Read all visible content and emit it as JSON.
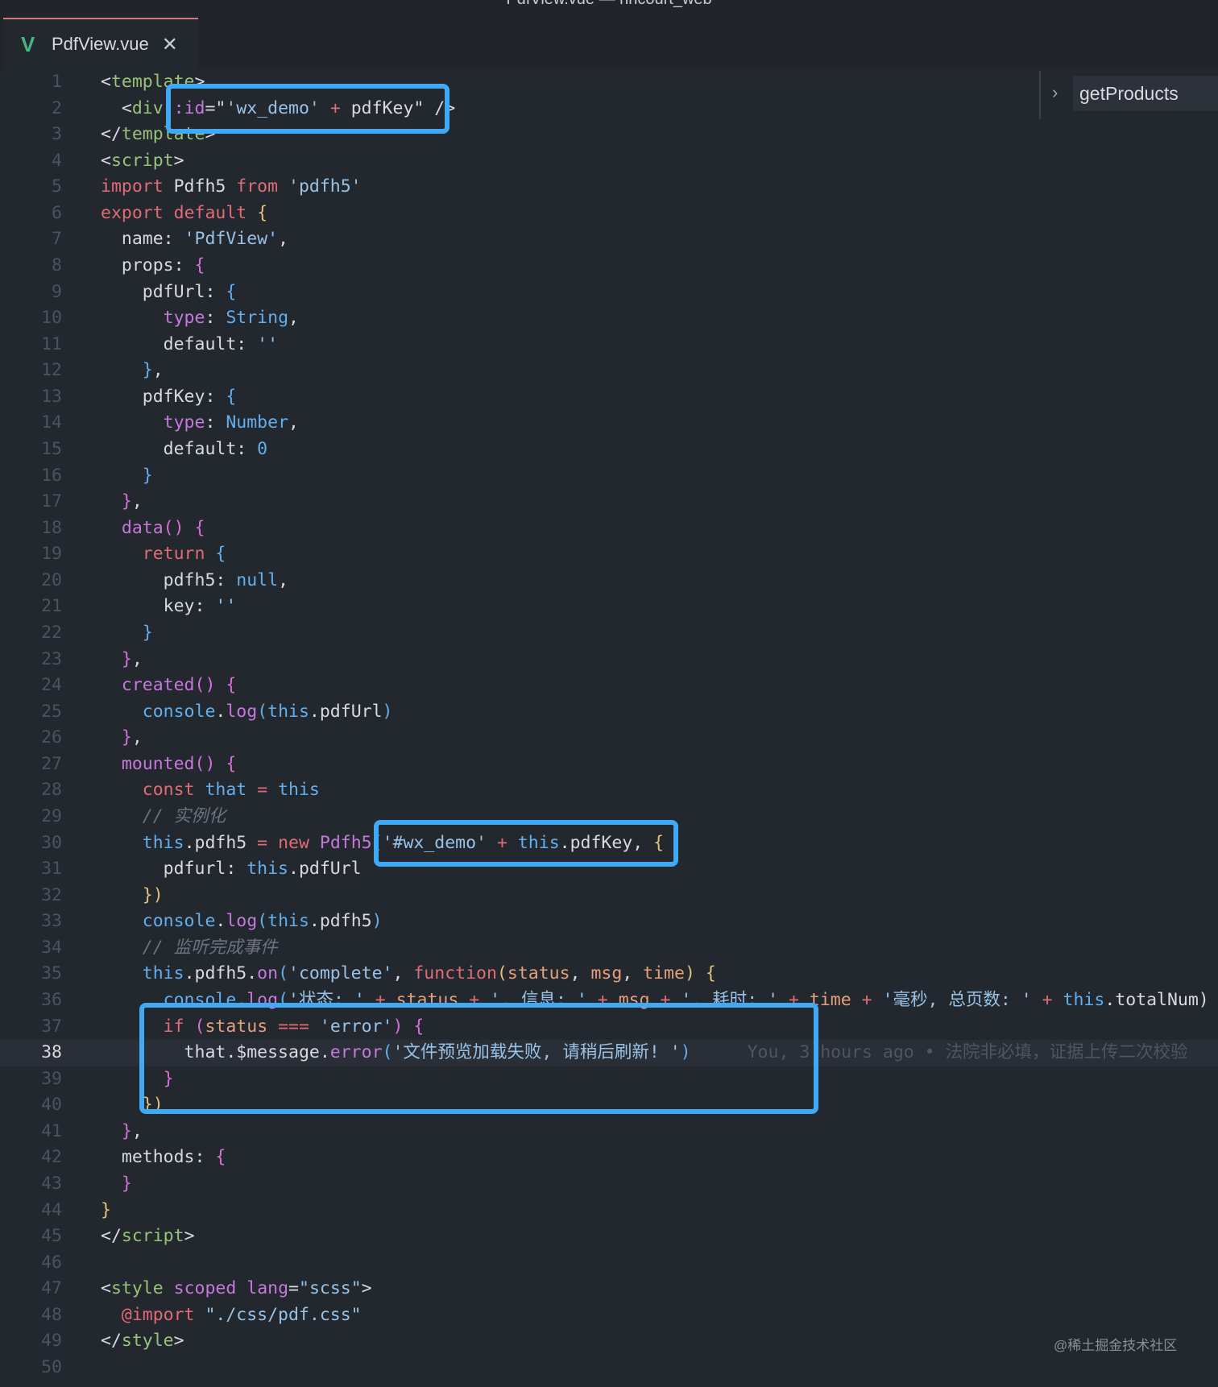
{
  "window": {
    "title": "PdfView.vue — hncourt_web"
  },
  "tab": {
    "icon": "vue-icon",
    "label": "PdfView.vue",
    "close": "✕"
  },
  "breadcrumb": {
    "item": "getProducts"
  },
  "colors": {
    "highlight_box": "#3fa9f5",
    "editor_bg": "#23272e"
  },
  "current_line": 38,
  "blame": "You, 3 hours ago • 法院非必填，证据上传二次校验",
  "watermark": "@稀土掘金技术社区",
  "lines": [
    [
      [
        "<",
        "p"
      ],
      [
        "template",
        "tag"
      ],
      [
        ">",
        "p"
      ]
    ],
    [
      [
        "  <",
        "p"
      ],
      [
        "div",
        "tag"
      ],
      [
        " ",
        "p"
      ],
      [
        ":id",
        "f"
      ],
      [
        "=\"",
        "p"
      ],
      [
        "'wx_demo'",
        "s"
      ],
      [
        " + ",
        "m"
      ],
      [
        "pdfKey",
        "p"
      ],
      [
        "\"",
        "p"
      ],
      [
        " />",
        "p"
      ]
    ],
    [
      [
        "</",
        "p"
      ],
      [
        "template",
        "tag"
      ],
      [
        ">",
        "p"
      ]
    ],
    [
      [
        "<",
        "p"
      ],
      [
        "script",
        "tag"
      ],
      [
        ">",
        "p"
      ]
    ],
    [
      [
        "import",
        "k"
      ],
      [
        " Pdfh5 ",
        "p"
      ],
      [
        "from",
        "k"
      ],
      [
        " ",
        "p"
      ],
      [
        "'pdfh5'",
        "s"
      ]
    ],
    [
      [
        "export",
        "k"
      ],
      [
        " ",
        "p"
      ],
      [
        "default",
        "k"
      ],
      [
        " ",
        "p"
      ],
      [
        "{",
        "y"
      ]
    ],
    [
      [
        "  name: ",
        "p"
      ],
      [
        "'PdfView'",
        "s"
      ],
      [
        ",",
        "p"
      ]
    ],
    [
      [
        "  props: ",
        "p"
      ],
      [
        "{",
        "pk"
      ]
    ],
    [
      [
        "    pdfUrl: ",
        "p"
      ],
      [
        "{",
        "b"
      ]
    ],
    [
      [
        "      ",
        "p"
      ],
      [
        "type",
        "f"
      ],
      [
        ": ",
        "p"
      ],
      [
        "String",
        "b"
      ],
      [
        ",",
        "p"
      ]
    ],
    [
      [
        "      default: ",
        "p"
      ],
      [
        "''",
        "s"
      ]
    ],
    [
      [
        "    ",
        "p"
      ],
      [
        "}",
        "b"
      ],
      [
        ",",
        "p"
      ]
    ],
    [
      [
        "    pdfKey: ",
        "p"
      ],
      [
        "{",
        "b"
      ]
    ],
    [
      [
        "      ",
        "p"
      ],
      [
        "type",
        "f"
      ],
      [
        ": ",
        "p"
      ],
      [
        "Number",
        "b"
      ],
      [
        ",",
        "p"
      ]
    ],
    [
      [
        "      default: ",
        "p"
      ],
      [
        "0",
        "n"
      ]
    ],
    [
      [
        "    ",
        "p"
      ],
      [
        "}",
        "b"
      ]
    ],
    [
      [
        "  ",
        "p"
      ],
      [
        "}",
        "pk"
      ],
      [
        ",",
        "p"
      ]
    ],
    [
      [
        "  ",
        "p"
      ],
      [
        "data",
        "f"
      ],
      [
        "()",
        "pk"
      ],
      [
        " ",
        "p"
      ],
      [
        "{",
        "pk"
      ]
    ],
    [
      [
        "    ",
        "p"
      ],
      [
        "return",
        "k"
      ],
      [
        " ",
        "p"
      ],
      [
        "{",
        "b"
      ]
    ],
    [
      [
        "      pdfh5: ",
        "p"
      ],
      [
        "null",
        "b"
      ],
      [
        ",",
        "p"
      ]
    ],
    [
      [
        "      key: ",
        "p"
      ],
      [
        "''",
        "s"
      ]
    ],
    [
      [
        "    ",
        "p"
      ],
      [
        "}",
        "b"
      ]
    ],
    [
      [
        "  ",
        "p"
      ],
      [
        "}",
        "pk"
      ],
      [
        ",",
        "p"
      ]
    ],
    [
      [
        "  ",
        "p"
      ],
      [
        "created",
        "f"
      ],
      [
        "()",
        "pk"
      ],
      [
        " ",
        "p"
      ],
      [
        "{",
        "pk"
      ]
    ],
    [
      [
        "    ",
        "p"
      ],
      [
        "console",
        "b"
      ],
      [
        ".",
        "p"
      ],
      [
        "log",
        "f"
      ],
      [
        "(",
        "b"
      ],
      [
        "this",
        "b"
      ],
      [
        ".pdfUrl",
        "p"
      ],
      [
        ")",
        "b"
      ]
    ],
    [
      [
        "  ",
        "p"
      ],
      [
        "}",
        "pk"
      ],
      [
        ",",
        "p"
      ]
    ],
    [
      [
        "  ",
        "p"
      ],
      [
        "mounted",
        "f"
      ],
      [
        "()",
        "pk"
      ],
      [
        " ",
        "p"
      ],
      [
        "{",
        "pk"
      ]
    ],
    [
      [
        "    ",
        "p"
      ],
      [
        "const",
        "k"
      ],
      [
        " ",
        "p"
      ],
      [
        "that",
        "b"
      ],
      [
        " = ",
        "m"
      ],
      [
        "this",
        "b"
      ]
    ],
    [
      [
        "    // 实例化",
        "c"
      ]
    ],
    [
      [
        "    ",
        "p"
      ],
      [
        "this",
        "b"
      ],
      [
        ".pdfh5 ",
        "p"
      ],
      [
        "=",
        "m"
      ],
      [
        " ",
        "p"
      ],
      [
        "new",
        "k"
      ],
      [
        " ",
        "p"
      ],
      [
        "Pdfh5",
        "f"
      ],
      [
        "(",
        "p"
      ],
      [
        "'#wx_demo'",
        "s"
      ],
      [
        " + ",
        "m"
      ],
      [
        "this",
        "b"
      ],
      [
        ".pdfKey, ",
        "p"
      ],
      [
        "{",
        "y"
      ]
    ],
    [
      [
        "      pdfurl: ",
        "p"
      ],
      [
        "this",
        "b"
      ],
      [
        ".pdfUrl",
        "p"
      ]
    ],
    [
      [
        "    ",
        "p"
      ],
      [
        "})",
        "y"
      ]
    ],
    [
      [
        "    ",
        "p"
      ],
      [
        "console",
        "b"
      ],
      [
        ".",
        "p"
      ],
      [
        "log",
        "f"
      ],
      [
        "(",
        "b"
      ],
      [
        "this",
        "b"
      ],
      [
        ".pdfh5",
        "p"
      ],
      [
        ")",
        "b"
      ]
    ],
    [
      [
        "    // 监听完成事件",
        "c"
      ]
    ],
    [
      [
        "    ",
        "p"
      ],
      [
        "this",
        "b"
      ],
      [
        ".pdfh5.",
        "p"
      ],
      [
        "on",
        "f"
      ],
      [
        "(",
        "b"
      ],
      [
        "'complete'",
        "s"
      ],
      [
        ", ",
        "p"
      ],
      [
        "function",
        "k"
      ],
      [
        "(",
        "y"
      ],
      [
        "status",
        "o"
      ],
      [
        ", ",
        "p"
      ],
      [
        "msg",
        "o"
      ],
      [
        ", ",
        "p"
      ],
      [
        "time",
        "o"
      ],
      [
        ")",
        "y"
      ],
      [
        " ",
        "p"
      ],
      [
        "{",
        "y"
      ]
    ],
    [
      [
        "      ",
        "p"
      ],
      [
        "console",
        "b"
      ],
      [
        ".",
        "p"
      ],
      [
        "log",
        "f"
      ],
      [
        "(",
        "b"
      ],
      [
        "'状态: '",
        "s"
      ],
      [
        " + ",
        "m"
      ],
      [
        "status",
        "o"
      ],
      [
        " + ",
        "m"
      ],
      [
        "', 信息: '",
        "s"
      ],
      [
        " + ",
        "m"
      ],
      [
        "msg",
        "o"
      ],
      [
        " + ",
        "m"
      ],
      [
        "', 耗时: '",
        "s"
      ],
      [
        " + ",
        "m"
      ],
      [
        "time",
        "o"
      ],
      [
        " + ",
        "m"
      ],
      [
        "'毫秒, 总页数: '",
        "s"
      ],
      [
        " + ",
        "m"
      ],
      [
        "this",
        "b"
      ],
      [
        ".totalNum)",
        "p"
      ]
    ],
    [
      [
        "      ",
        "p"
      ],
      [
        "if",
        "k"
      ],
      [
        " ",
        "p"
      ],
      [
        "(",
        "pk"
      ],
      [
        "status",
        "o"
      ],
      [
        " === ",
        "m"
      ],
      [
        "'error'",
        "s"
      ],
      [
        ")",
        "pk"
      ],
      [
        " ",
        "p"
      ],
      [
        "{",
        "pk"
      ]
    ],
    [
      [
        "        that.",
        "p"
      ],
      [
        "$message",
        "p"
      ],
      [
        ".",
        "p"
      ],
      [
        "error",
        "f"
      ],
      [
        "(",
        "b"
      ],
      [
        "'文件预览加载失败, 请稍后刷新! '",
        "s"
      ],
      [
        ")",
        "b"
      ]
    ],
    [
      [
        "      ",
        "p"
      ],
      [
        "}",
        "pk"
      ]
    ],
    [
      [
        "    ",
        "p"
      ],
      [
        "})",
        "y"
      ]
    ],
    [
      [
        "  ",
        "p"
      ],
      [
        "}",
        "pk"
      ],
      [
        ",",
        "p"
      ]
    ],
    [
      [
        "  methods: ",
        "p"
      ],
      [
        "{",
        "pk"
      ]
    ],
    [
      [
        "  ",
        "p"
      ],
      [
        "}",
        "pk"
      ]
    ],
    [
      [
        "}",
        "y"
      ]
    ],
    [
      [
        "</",
        "p"
      ],
      [
        "script",
        "tag"
      ],
      [
        ">",
        "p"
      ]
    ],
    [
      [
        "",
        "p"
      ]
    ],
    [
      [
        "<",
        "p"
      ],
      [
        "style",
        "tag"
      ],
      [
        " ",
        "p"
      ],
      [
        "scoped",
        "f"
      ],
      [
        " ",
        "p"
      ],
      [
        "lang",
        "f"
      ],
      [
        "=",
        "p"
      ],
      [
        "\"scss\"",
        "s"
      ],
      [
        ">",
        "p"
      ]
    ],
    [
      [
        "  ",
        "p"
      ],
      [
        "@import",
        "k"
      ],
      [
        " ",
        "p"
      ],
      [
        "\"./css/pdf.css\"",
        "s"
      ]
    ],
    [
      [
        "</",
        "p"
      ],
      [
        "style",
        "tag"
      ],
      [
        ">",
        "p"
      ]
    ],
    [
      [
        "",
        "p"
      ]
    ]
  ]
}
